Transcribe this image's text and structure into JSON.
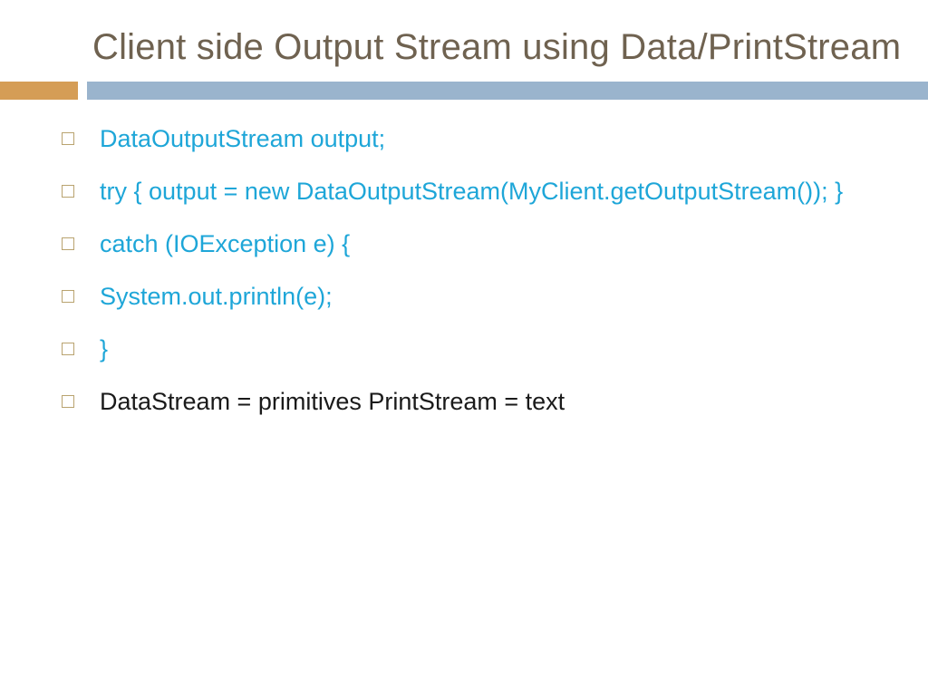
{
  "title": "Client side Output Stream using Data/PrintStream",
  "items": [
    {
      "text": "DataOutputStream output;",
      "color": "blue"
    },
    {
      "text": " try { output = new DataOutputStream(MyClient.getOutputStream()); }",
      "color": "blue"
    },
    {
      "text": " catch (IOException e) {",
      "color": "blue"
    },
    {
      "text": "System.out.println(e);",
      "color": "blue"
    },
    {
      "text": "}",
      "color": "blue"
    },
    {
      "text": "DataStream = primitives PrintStream = text",
      "color": "black"
    }
  ],
  "colors": {
    "title": "#6f6250",
    "accent_orange": "#d59d56",
    "accent_blue": "#9ab4cd",
    "code_blue": "#1ea6d8",
    "bullet_border": "#b9a36f"
  }
}
